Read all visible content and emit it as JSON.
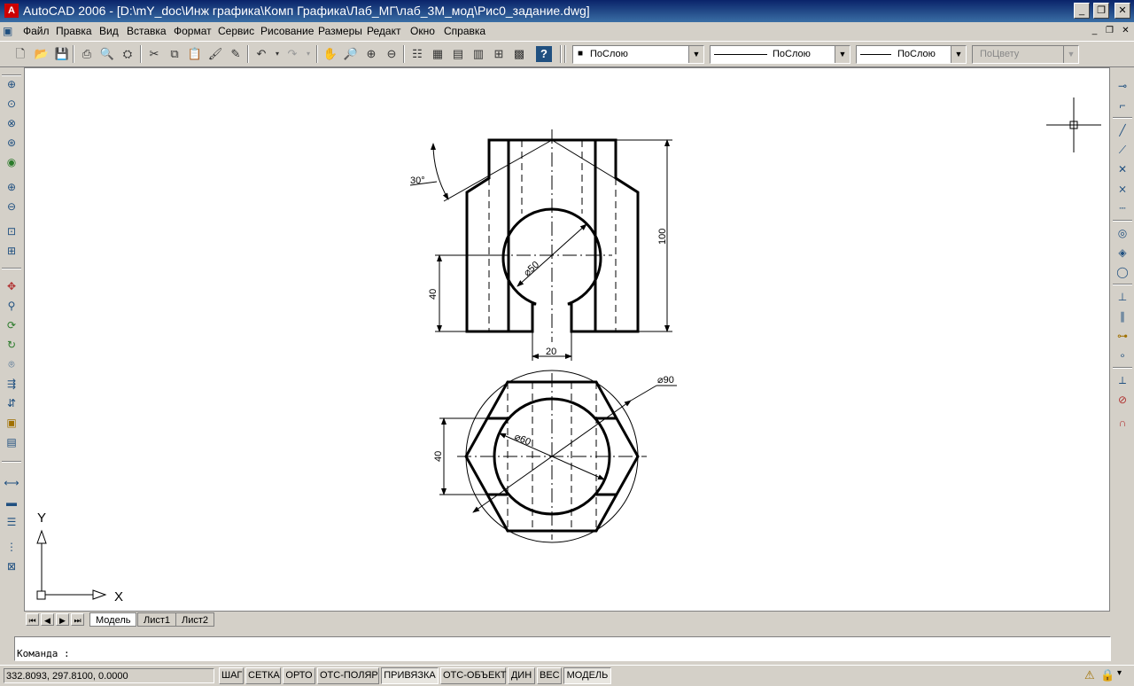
{
  "window": {
    "title": "AutoCAD 2006 - [D:\\mY_doc\\Инж графика\\Комп Графика\\Лаб_МГ\\лаб_3М_мод\\Рис0_задание.dwg]",
    "app_icon": "autocad-logo"
  },
  "menu": {
    "items": [
      "Файл",
      "Правка",
      "Вид",
      "Вставка",
      "Формат",
      "Сервис",
      "Рисование",
      "Размеры",
      "Редакт",
      "Окно",
      "Справка"
    ]
  },
  "toolbar": {
    "layer_color_combo": "ПоСлою",
    "linetype_combo": "ПоСлою",
    "lineweight_combo": "ПоСлою",
    "plotstyle_combo": "ПоЦвету"
  },
  "drawing": {
    "dim_angle": "30°",
    "dim_height_total": "100",
    "dim_hole_top": "⌀50",
    "dim_height_lower": "40",
    "dim_slot_width": "20",
    "dim_outer_circle": "⌀90",
    "dim_inner_circle": "⌀60",
    "dim_hex_height": "40",
    "ucs_x": "X",
    "ucs_y": "Y"
  },
  "tabs": {
    "items": [
      "Модель",
      "Лист1",
      "Лист2"
    ],
    "active": "Модель"
  },
  "command": {
    "prompt": "Команда :"
  },
  "status": {
    "coordinates": "332.8093, 297.8100, 0.0000",
    "buttons": [
      "ШАГ",
      "СЕТКА",
      "ОРТО",
      "ОТС-ПОЛЯР",
      "ПРИВЯЗКА",
      "ОТС-ОБЪЕКТ",
      "ДИН",
      "ВЕС",
      "МОДЕЛЬ"
    ],
    "active_buttons": [
      "ПРИВЯЗКА",
      "МОДЕЛЬ"
    ]
  }
}
